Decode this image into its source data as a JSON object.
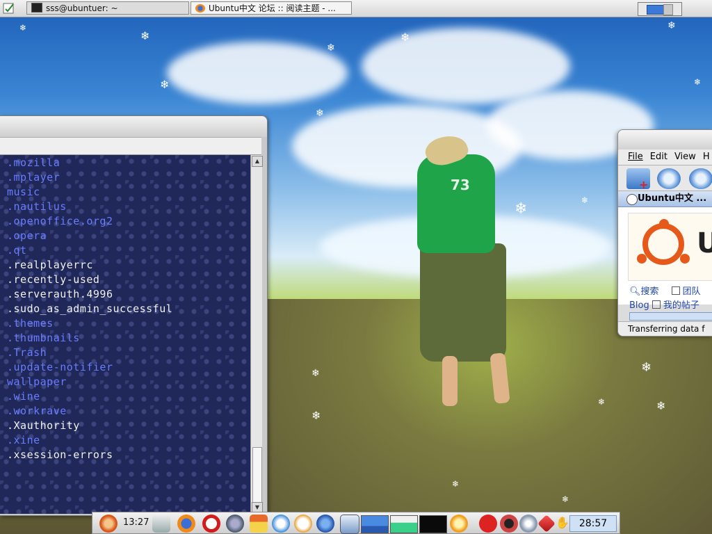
{
  "top_panel": {
    "tasks": [
      {
        "label": "sss@ubuntuer: ~",
        "active": false
      },
      {
        "label": "Ubuntu中文 论坛 :: 阅读主题 - ...",
        "active": true
      }
    ]
  },
  "terminal": {
    "lines": [
      {
        "text": ".mozilla",
        "type": "dir"
      },
      {
        "text": ".mplayer",
        "type": "dir"
      },
      {
        "text": "music",
        "type": "dir"
      },
      {
        "text": ".nautilus",
        "type": "dir"
      },
      {
        "text": ".openoffice.org2",
        "type": "dir"
      },
      {
        "text": ".opera",
        "type": "dir"
      },
      {
        "text": ".qt",
        "type": "dir"
      },
      {
        "text": ".realplayerrc",
        "type": "file"
      },
      {
        "text": ".recently-used",
        "type": "file"
      },
      {
        "text": ".serverauth.4996",
        "type": "file"
      },
      {
        "text": ".sudo_as_admin_successful",
        "type": "file"
      },
      {
        "text": ".themes",
        "type": "dir"
      },
      {
        "text": ".thumbnails",
        "type": "dir"
      },
      {
        "text": ".Trash",
        "type": "dir"
      },
      {
        "text": ".update-notifier",
        "type": "dir"
      },
      {
        "text": "wallpaper",
        "type": "dir"
      },
      {
        "text": ".wine",
        "type": "dir"
      },
      {
        "text": ".workrave",
        "type": "dir"
      },
      {
        "text": ".Xauthority",
        "type": "file"
      },
      {
        "text": ".xine",
        "type": "dir"
      },
      {
        "text": ".xsession-errors",
        "type": "file"
      }
    ],
    "colors": {
      "dir": "#6a7cff",
      "file": "#f2f2f2",
      "background": "#20285a"
    }
  },
  "browser": {
    "menu": {
      "file": "File",
      "edit": "Edit",
      "view": "View",
      "help": "H"
    },
    "tab_title": "Ubuntu中文 ...",
    "nav": {
      "search": "搜索",
      "team": "团队",
      "blog": "Blog",
      "my_posts": "我的帖子"
    },
    "status": "Transferring data f"
  },
  "bottom_panel": {
    "left_clock": "13:27",
    "right_clock": "28:57"
  },
  "wallpaper": {
    "shirt_number": "73"
  },
  "icons": [
    "ubuntu-logo-icon",
    "music-player-icon",
    "firefox-icon",
    "opera-icon",
    "file-manager-icon",
    "home-icon",
    "messenger-icon",
    "clock-app-icon",
    "thunderbird-icon",
    "trash-icon",
    "cpu-monitor-icon",
    "memory-monitor-icon",
    "network-monitor-icon",
    "sun-icon",
    "stop-icon",
    "record-icon",
    "eye-icon",
    "ruby-icon",
    "hand-icon"
  ]
}
